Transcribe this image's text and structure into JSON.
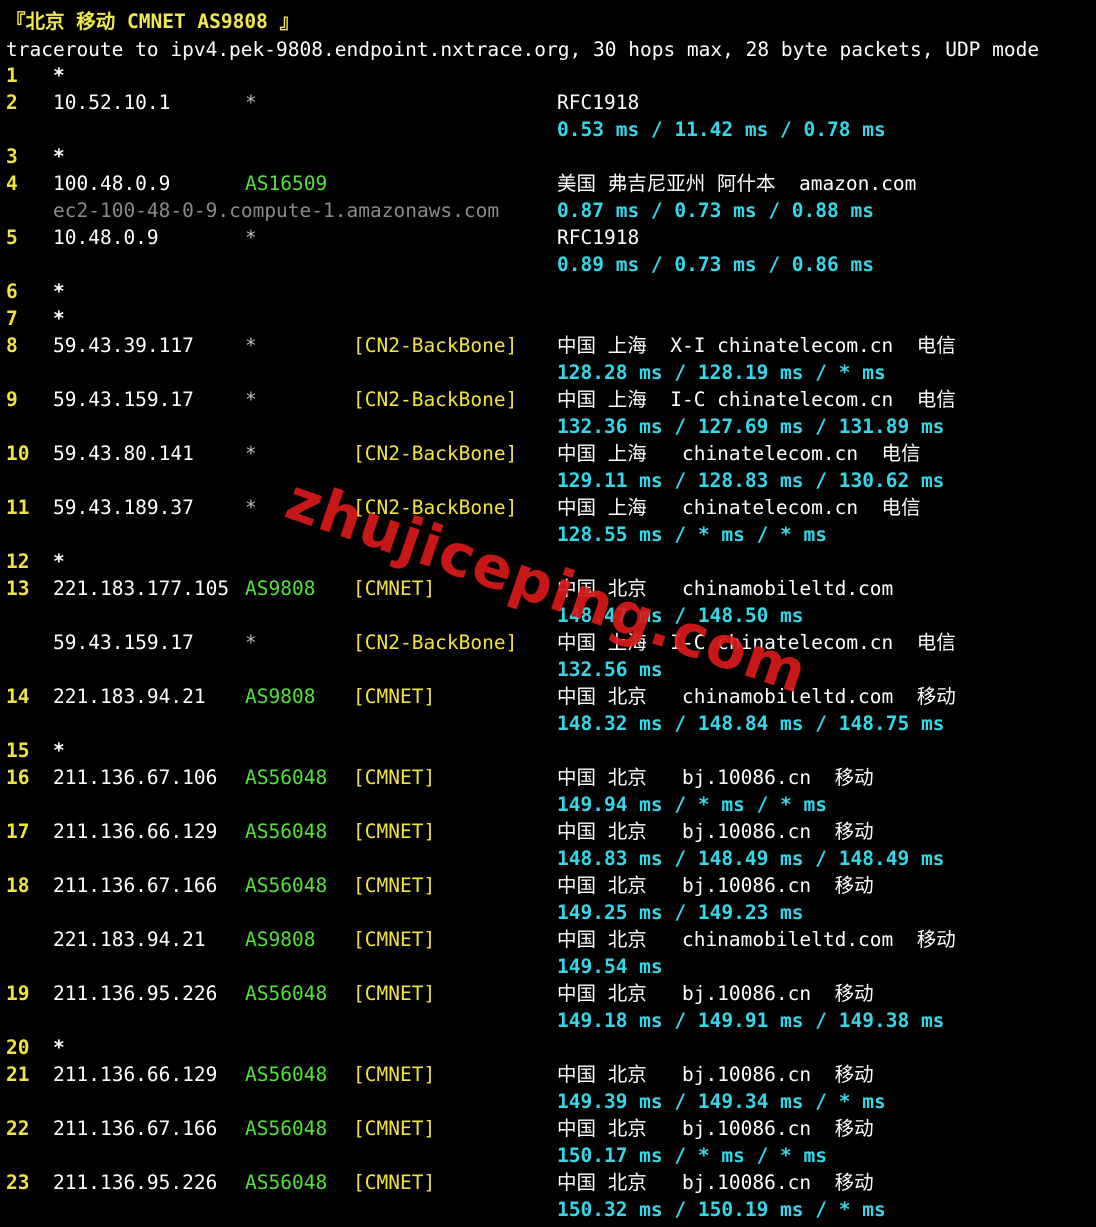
{
  "header": {
    "title": "『北京 移动 CMNET AS9808 』",
    "command": "traceroute to ipv4.pek-9808.endpoint.nxtrace.org, 30 hops max, 28 byte packets, UDP mode"
  },
  "watermark": "zhujiceping.com",
  "colors": {
    "background": "#000000",
    "hop_number": "#f0e442",
    "ip": "#ffffff",
    "asn": "#55e03b",
    "tag": "#f0e442",
    "rtt": "#35d7e9",
    "hostname": "#8a8a8a",
    "watermark": "#d81a1a"
  },
  "rows": [
    {
      "hop": "1",
      "ip": "*",
      "asn": "",
      "tag": "",
      "geo": "",
      "rtt": "",
      "host": ""
    },
    {
      "hop": "2",
      "ip": "10.52.10.1",
      "asn": "*",
      "tag": "",
      "geo": "RFC1918",
      "rtt": "0.53 ms / 11.42 ms / 0.78 ms",
      "host": ""
    },
    {
      "hop": "3",
      "ip": "*",
      "asn": "",
      "tag": "",
      "geo": "",
      "rtt": "",
      "host": ""
    },
    {
      "hop": "4",
      "ip": "100.48.0.9",
      "asn": "AS16509",
      "tag": "",
      "geo": "美国 弗吉尼亚州 阿什本  amazon.com",
      "rtt": "0.87 ms / 0.73 ms / 0.88 ms",
      "host": "ec2-100-48-0-9.compute-1.amazonaws.com"
    },
    {
      "hop": "5",
      "ip": "10.48.0.9",
      "asn": "*",
      "tag": "",
      "geo": "RFC1918",
      "rtt": "0.89 ms / 0.73 ms / 0.86 ms",
      "host": ""
    },
    {
      "hop": "6",
      "ip": "*",
      "asn": "",
      "tag": "",
      "geo": "",
      "rtt": "",
      "host": ""
    },
    {
      "hop": "7",
      "ip": "*",
      "asn": "",
      "tag": "",
      "geo": "",
      "rtt": "",
      "host": ""
    },
    {
      "hop": "8",
      "ip": "59.43.39.117",
      "asn": "*",
      "tag": "[CN2-BackBone]",
      "geo": "中国 上海  X-I chinatelecom.cn  电信",
      "rtt": "128.28 ms / 128.19 ms / * ms",
      "host": ""
    },
    {
      "hop": "9",
      "ip": "59.43.159.17",
      "asn": "*",
      "tag": "[CN2-BackBone]",
      "geo": "中国 上海  I-C chinatelecom.cn  电信",
      "rtt": "132.36 ms / 127.69 ms / 131.89 ms",
      "host": ""
    },
    {
      "hop": "10",
      "ip": "59.43.80.141",
      "asn": "*",
      "tag": "[CN2-BackBone]",
      "geo": "中国 上海   chinatelecom.cn  电信",
      "rtt": "129.11 ms / 128.83 ms / 130.62 ms",
      "host": ""
    },
    {
      "hop": "11",
      "ip": "59.43.189.37",
      "asn": "*",
      "tag": "[CN2-BackBone]",
      "geo": "中国 上海   chinatelecom.cn  电信",
      "rtt": "128.55 ms / * ms / * ms",
      "host": ""
    },
    {
      "hop": "12",
      "ip": "*",
      "asn": "",
      "tag": "",
      "geo": "",
      "rtt": "",
      "host": ""
    },
    {
      "hop": "13",
      "ip": "221.183.177.105",
      "asn": "AS9808",
      "tag": "[CMNET]",
      "geo": "中国 北京   chinamobileltd.com",
      "rtt": "148.47 ms / 148.50 ms",
      "host": ""
    },
    {
      "hop": "",
      "ip": "59.43.159.17",
      "asn": "*",
      "tag": "[CN2-BackBone]",
      "geo": "中国 上海  I-C chinatelecom.cn  电信",
      "rtt": "132.56 ms",
      "host": ""
    },
    {
      "hop": "14",
      "ip": "221.183.94.21",
      "asn": "AS9808",
      "tag": "[CMNET]",
      "geo": "中国 北京   chinamobileltd.com  移动",
      "rtt": "148.32 ms / 148.84 ms / 148.75 ms",
      "host": ""
    },
    {
      "hop": "15",
      "ip": "*",
      "asn": "",
      "tag": "",
      "geo": "",
      "rtt": "",
      "host": ""
    },
    {
      "hop": "16",
      "ip": "211.136.67.106",
      "asn": "AS56048",
      "tag": "[CMNET]",
      "geo": "中国 北京   bj.10086.cn  移动",
      "rtt": "149.94 ms / * ms / * ms",
      "host": ""
    },
    {
      "hop": "17",
      "ip": "211.136.66.129",
      "asn": "AS56048",
      "tag": "[CMNET]",
      "geo": "中国 北京   bj.10086.cn  移动",
      "rtt": "148.83 ms / 148.49 ms / 148.49 ms",
      "host": ""
    },
    {
      "hop": "18",
      "ip": "211.136.67.166",
      "asn": "AS56048",
      "tag": "[CMNET]",
      "geo": "中国 北京   bj.10086.cn  移动",
      "rtt": "149.25 ms / 149.23 ms",
      "host": ""
    },
    {
      "hop": "",
      "ip": "221.183.94.21",
      "asn": "AS9808",
      "tag": "[CMNET]",
      "geo": "中国 北京   chinamobileltd.com  移动",
      "rtt": "149.54 ms",
      "host": ""
    },
    {
      "hop": "19",
      "ip": "211.136.95.226",
      "asn": "AS56048",
      "tag": "[CMNET]",
      "geo": "中国 北京   bj.10086.cn  移动",
      "rtt": "149.18 ms / 149.91 ms / 149.38 ms",
      "host": ""
    },
    {
      "hop": "20",
      "ip": "*",
      "asn": "",
      "tag": "",
      "geo": "",
      "rtt": "",
      "host": ""
    },
    {
      "hop": "21",
      "ip": "211.136.66.129",
      "asn": "AS56048",
      "tag": "[CMNET]",
      "geo": "中国 北京   bj.10086.cn  移动",
      "rtt": "149.39 ms / 149.34 ms / * ms",
      "host": ""
    },
    {
      "hop": "22",
      "ip": "211.136.67.166",
      "asn": "AS56048",
      "tag": "[CMNET]",
      "geo": "中国 北京   bj.10086.cn  移动",
      "rtt": "150.17 ms / * ms / * ms",
      "host": ""
    },
    {
      "hop": "23",
      "ip": "211.136.95.226",
      "asn": "AS56048",
      "tag": "[CMNET]",
      "geo": "中国 北京   bj.10086.cn  移动",
      "rtt": "150.32 ms / 150.19 ms / * ms",
      "host": ""
    }
  ]
}
